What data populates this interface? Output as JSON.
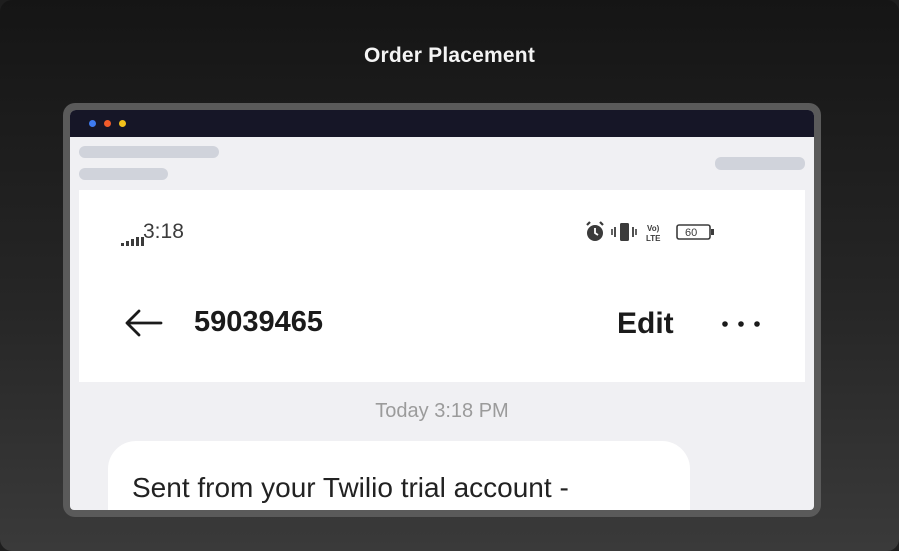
{
  "header": {
    "title": "Order Placement"
  },
  "phone": {
    "status_time": "3:18",
    "status_icons": [
      "alarm-icon",
      "vibrate-icon",
      "volte-icon",
      "battery-icon"
    ],
    "volte_top": "Vo)",
    "volte_bottom": "LTE",
    "battery_level": "60",
    "contact_number": "59039465",
    "edit_label": "Edit",
    "message_timestamp": "Today 3:18 PM",
    "message_text": "Sent from your Twilio trial account -"
  },
  "colors": {
    "background_top": "#151515",
    "window_titlebar": "#161627",
    "dot_blue": "#3e7bf0",
    "dot_orange": "#f15b2a",
    "dot_yellow": "#f3c21b"
  }
}
